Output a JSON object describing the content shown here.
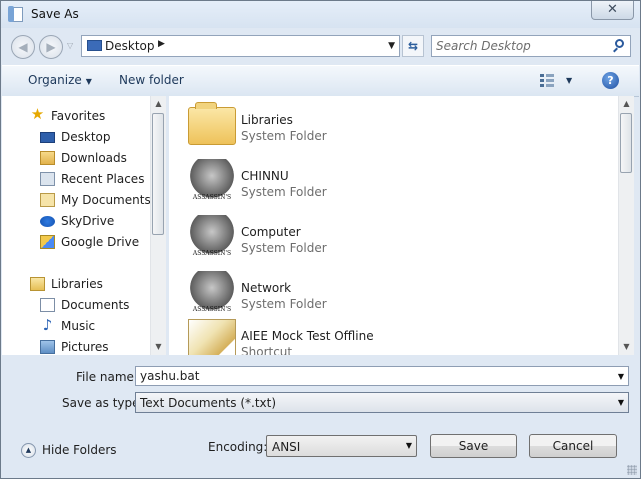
{
  "window": {
    "title": "Save As",
    "close_glyph": "✕"
  },
  "address_bar": {
    "location": "Desktop"
  },
  "search": {
    "placeholder": "Search Desktop"
  },
  "toolbar": {
    "organize_label": "Organize",
    "new_folder_label": "New folder"
  },
  "nav_pane": {
    "items": [
      {
        "label": "Favorites",
        "icon": "star-icon",
        "level": 0
      },
      {
        "label": "Desktop",
        "icon": "desktop-icon",
        "level": 1
      },
      {
        "label": "Downloads",
        "icon": "downloads-folder-icon",
        "level": 1
      },
      {
        "label": "Recent Places",
        "icon": "recent-places-icon",
        "level": 1
      },
      {
        "label": "My Documents",
        "icon": "documents-folder-icon",
        "level": 1
      },
      {
        "label": "SkyDrive",
        "icon": "skydrive-icon",
        "level": 1
      },
      {
        "label": "Google Drive",
        "icon": "google-drive-icon",
        "level": 1
      },
      {
        "label": "Libraries",
        "icon": "libraries-icon",
        "level": 0
      },
      {
        "label": "Documents",
        "icon": "document-icon",
        "level": 1
      },
      {
        "label": "Music",
        "icon": "music-icon",
        "level": 1
      },
      {
        "label": "Pictures",
        "icon": "pictures-icon",
        "level": 1
      }
    ]
  },
  "files": [
    {
      "name": "Libraries",
      "type": "System Folder",
      "icon": "libraries-folder-icon"
    },
    {
      "name": "CHINNU",
      "type": "System Folder",
      "icon": "user-folder-icon"
    },
    {
      "name": "Computer",
      "type": "System Folder",
      "icon": "computer-icon"
    },
    {
      "name": "Network",
      "type": "System Folder",
      "icon": "network-icon"
    },
    {
      "name": "AIEE Mock Test Offline",
      "type": "Shortcut",
      "icon": "shortcut-icon"
    }
  ],
  "form": {
    "file_name_label": "File name:",
    "file_name_value": "yashu.bat",
    "save_type_label": "Save as type:",
    "save_type_value": "Text Documents (*.txt)",
    "encoding_label": "Encoding:",
    "encoding_value": "ANSI"
  },
  "footer": {
    "hide_folders_label": "Hide Folders",
    "save_label": "Save",
    "cancel_label": "Cancel"
  }
}
